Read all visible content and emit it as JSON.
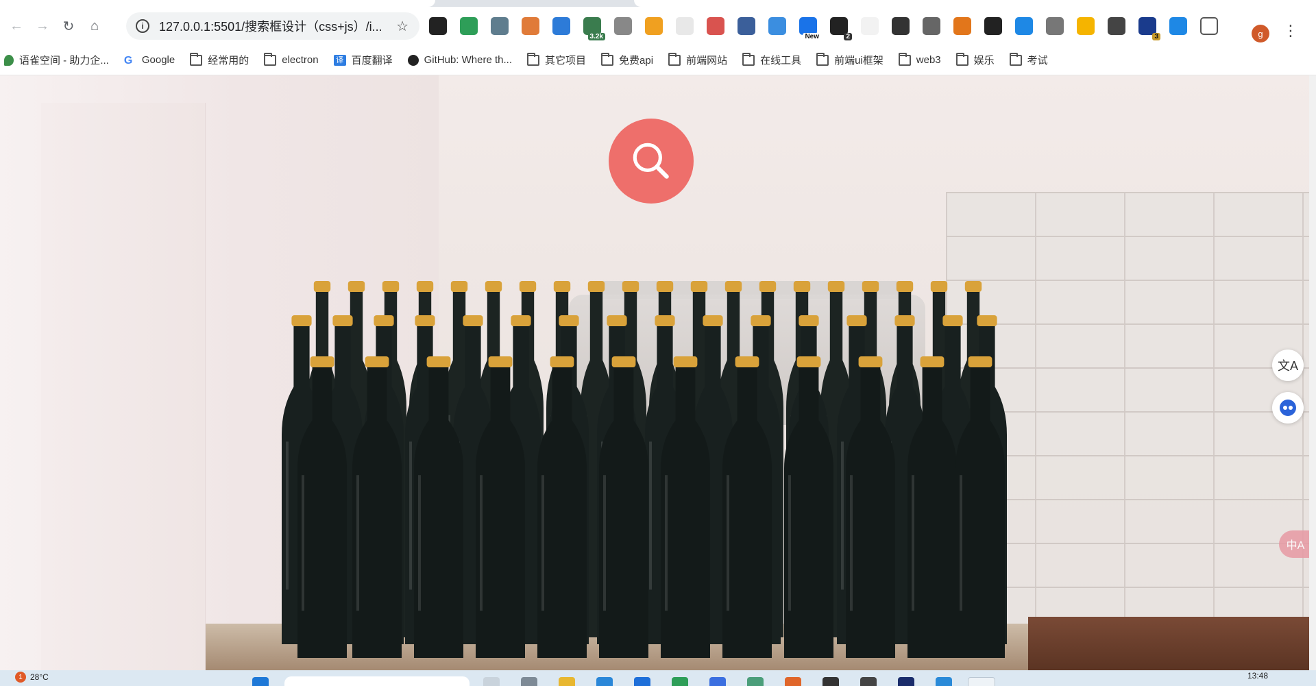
{
  "browser": {
    "url": "127.0.0.1:5501/搜索框设计（css+js）/i...",
    "profile_initial": "g",
    "extensions": [
      {
        "name": "tampermonkey-icon",
        "color": "#222222",
        "badge": ""
      },
      {
        "name": "shield-icon",
        "color": "#2e9e58",
        "badge": ""
      },
      {
        "name": "star-ext-icon",
        "color": "#5f7d8e",
        "badge": ""
      },
      {
        "name": "orange-ext-icon",
        "color": "#e07b39",
        "badge": ""
      },
      {
        "name": "globe-ext-icon",
        "color": "#2d7bd8",
        "badge": ""
      },
      {
        "name": "counter-ext-icon",
        "color": "#3a7c4e",
        "badge": "3.2k"
      },
      {
        "name": "cat-ext-icon",
        "color": "#888888",
        "badge": ""
      },
      {
        "name": "chrome-ext-icon",
        "color": "#f0a020",
        "badge": ""
      },
      {
        "name": "blank-ext-icon",
        "color": "#e8e8e8",
        "badge": ""
      },
      {
        "name": "translate-ext-icon",
        "color": "#d9534f",
        "badge": ""
      },
      {
        "name": "face-ext-icon",
        "color": "#3b5f9a",
        "badge": ""
      },
      {
        "name": "lens-ext-icon",
        "color": "#3b8ee0",
        "badge": ""
      },
      {
        "name": "new-ext-icon",
        "color": "#1a73e8",
        "badge": "New"
      },
      {
        "name": "dark-ext-icon",
        "color": "#222222",
        "badge": "2"
      },
      {
        "name": "y-ext-icon",
        "color": "#f2f2f2",
        "badge": ""
      },
      {
        "name": "circle-ext-icon",
        "color": "#333333",
        "badge": ""
      },
      {
        "name": "docs-ext-icon",
        "color": "#666666",
        "badge": ""
      },
      {
        "name": "fox-ext-icon",
        "color": "#e2761b",
        "badge": ""
      },
      {
        "name": "download-ext-icon",
        "color": "#222222",
        "badge": ""
      },
      {
        "name": "eye-ext-icon",
        "color": "#1e88e5",
        "badge": ""
      },
      {
        "name": "n-ext-icon",
        "color": "#777777",
        "badge": ""
      },
      {
        "name": "people-ext-icon",
        "color": "#f5b400",
        "badge": ""
      },
      {
        "name": "a-ext-icon",
        "color": "#444444",
        "badge": ""
      },
      {
        "name": "box-ext-icon",
        "color": "#1a3b8c",
        "badge": "3"
      },
      {
        "name": "figure-ext-icon",
        "color": "#1e88e5",
        "badge": ""
      },
      {
        "name": "puzzle-icon",
        "color": "#ffffff",
        "badge": ""
      }
    ]
  },
  "bookmarks": [
    {
      "label": "语雀空间 - 助力企...",
      "icon": "yuque-icon"
    },
    {
      "label": "Google",
      "icon": "google-icon"
    },
    {
      "label": "经常用的",
      "icon": "folder-icon"
    },
    {
      "label": "electron",
      "icon": "folder-icon"
    },
    {
      "label": "百度翻译",
      "icon": "baidu-translate-icon"
    },
    {
      "label": "GitHub: Where th...",
      "icon": "github-icon"
    },
    {
      "label": "其它项目",
      "icon": "folder-icon"
    },
    {
      "label": "免费api",
      "icon": "folder-icon"
    },
    {
      "label": "前端网站",
      "icon": "folder-icon"
    },
    {
      "label": "在线工具",
      "icon": "folder-icon"
    },
    {
      "label": "前端ui框架",
      "icon": "folder-icon"
    },
    {
      "label": "web3",
      "icon": "folder-icon"
    },
    {
      "label": "娱乐",
      "icon": "folder-icon"
    },
    {
      "label": "考试",
      "icon": "folder-icon"
    }
  ],
  "page": {
    "search_button_color": "#ee6f6b",
    "side_buttons": [
      {
        "name": "translate-float-icon",
        "label": "文A"
      },
      {
        "name": "assistant-float-icon",
        "label": ""
      }
    ],
    "pink_tab_label": "中A"
  },
  "taskbar": {
    "weather_badge": "1",
    "temperature": "28°C",
    "time": "13:48"
  }
}
